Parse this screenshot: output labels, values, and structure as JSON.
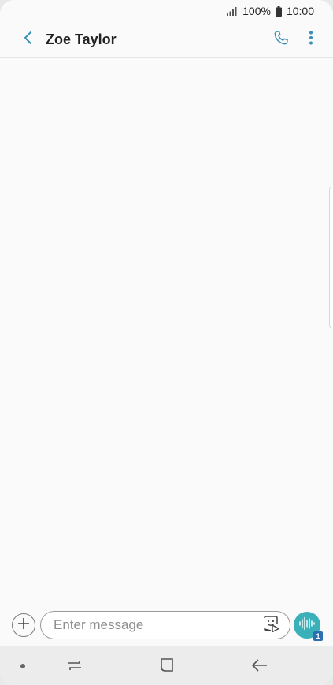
{
  "status_bar": {
    "battery": "100%",
    "time": "10:00"
  },
  "header": {
    "contact_name": "Zoe Taylor"
  },
  "composer": {
    "placeholder": "Enter message",
    "sim_badge": "1"
  },
  "icons": {
    "back": "chevron-left-icon",
    "call": "phone-icon",
    "more": "more-vert-icon",
    "attach": "plus-icon",
    "sticker": "sticker-icon",
    "voice": "voice-wave-icon"
  },
  "colors": {
    "accent": "#3a8fb7",
    "voice_button": "#3ab0b9",
    "sim_badge": "#2c6fb0"
  }
}
